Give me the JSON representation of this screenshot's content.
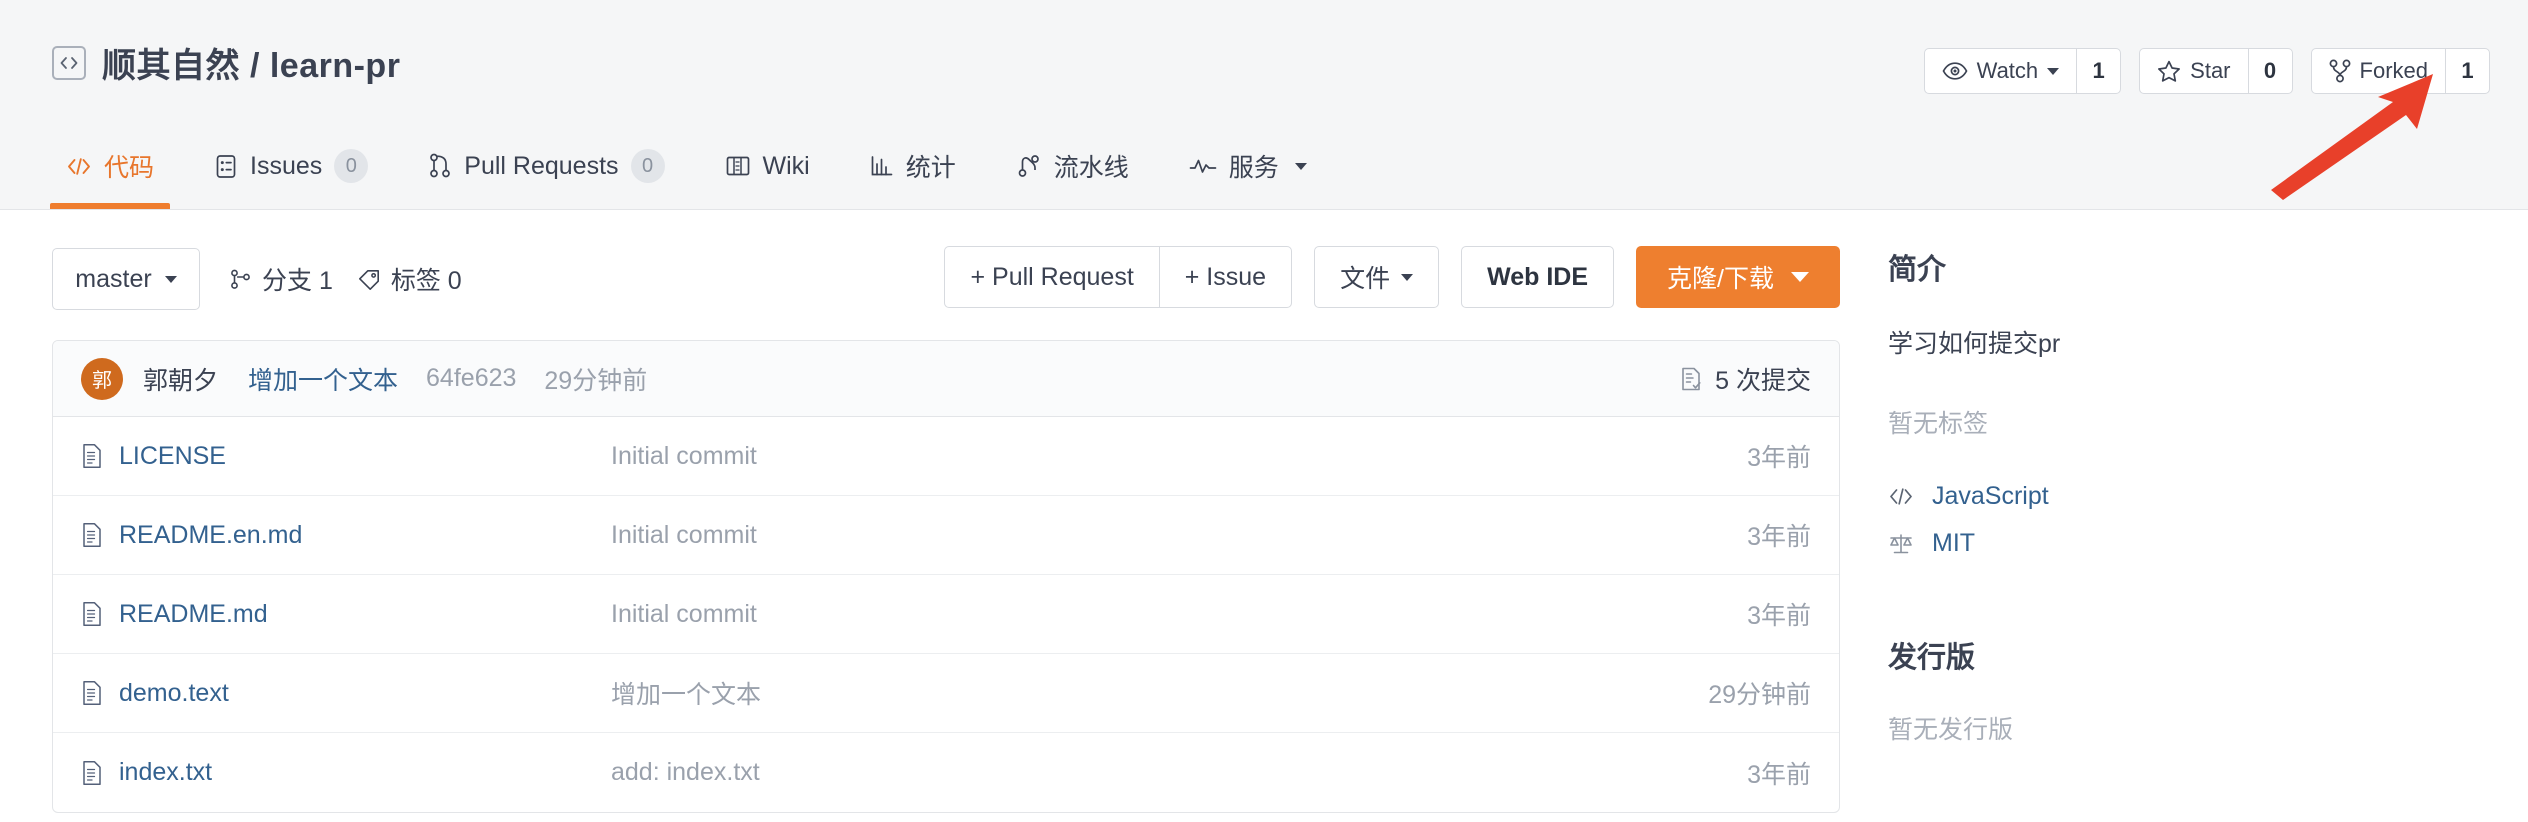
{
  "header": {
    "repo_icon": "code-brackets-icon",
    "title": "顺其自然 / learn-pr",
    "actions": [
      {
        "icon": "eye-icon",
        "label": "Watch",
        "has_caret": true,
        "count": "1",
        "name": "watch"
      },
      {
        "icon": "star-icon",
        "label": "Star",
        "has_caret": false,
        "count": "0",
        "name": "star"
      },
      {
        "icon": "fork-icon",
        "label": "Forked",
        "has_caret": false,
        "count": "1",
        "name": "forked"
      }
    ],
    "tabs": [
      {
        "icon": "code-icon",
        "label": "代码",
        "badge": null,
        "active": true,
        "caret": false,
        "name": "code"
      },
      {
        "icon": "issues-icon",
        "label": "Issues",
        "badge": "0",
        "active": false,
        "caret": false,
        "name": "issues"
      },
      {
        "icon": "pull-request-icon",
        "label": "Pull Requests",
        "badge": "0",
        "active": false,
        "caret": false,
        "name": "pull-requests"
      },
      {
        "icon": "wiki-icon",
        "label": "Wiki",
        "badge": null,
        "active": false,
        "caret": false,
        "name": "wiki"
      },
      {
        "icon": "chart-icon",
        "label": "统计",
        "badge": null,
        "active": false,
        "caret": false,
        "name": "statistics"
      },
      {
        "icon": "pipeline-icon",
        "label": "流水线",
        "badge": null,
        "active": false,
        "caret": false,
        "name": "pipeline"
      },
      {
        "icon": "service-icon",
        "label": "服务",
        "badge": null,
        "active": false,
        "caret": true,
        "name": "services"
      }
    ]
  },
  "toolbar": {
    "branch_selected": "master",
    "branch_count_label": "分支 1",
    "tag_count_label": "标签 0",
    "pull_request_button": "+ Pull Request",
    "issue_button": "+ Issue",
    "files_button": "文件",
    "web_ide_button": "Web IDE",
    "clone_button": "克隆/下载"
  },
  "commit_bar": {
    "avatar_initial": "郭",
    "author": "郭朝夕",
    "message": "增加一个文本",
    "sha": "64fe623",
    "time": "29分钟前",
    "commit_count_label": "5 次提交"
  },
  "files": [
    {
      "icon": "file-icon",
      "name": "LICENSE",
      "message": "Initial commit",
      "time": "3年前"
    },
    {
      "icon": "file-icon",
      "name": "README.en.md",
      "message": "Initial commit",
      "time": "3年前"
    },
    {
      "icon": "file-icon",
      "name": "README.md",
      "message": "Initial commit",
      "time": "3年前"
    },
    {
      "icon": "file-icon",
      "name": "demo.text",
      "message": "增加一个文本",
      "time": "29分钟前"
    },
    {
      "icon": "file-icon",
      "name": "index.txt",
      "message": "add: index.txt",
      "time": "3年前"
    }
  ],
  "sidebar": {
    "about_heading": "简介",
    "description": "学习如何提交pr",
    "no_tags": "暂无标签",
    "language": "JavaScript",
    "license": "MIT",
    "releases_heading": "发行版",
    "no_releases": "暂无发行版"
  },
  "annotation": {
    "arrow_color": "#e8402a",
    "points_at": "forked-button"
  },
  "colors": {
    "accent_orange": "#ee7f2f",
    "link_blue": "#33618f",
    "text_dark": "#3b4252",
    "text_muted": "#9aa1ac",
    "header_bg": "#f5f6f7",
    "border": "#e3e5e8"
  }
}
